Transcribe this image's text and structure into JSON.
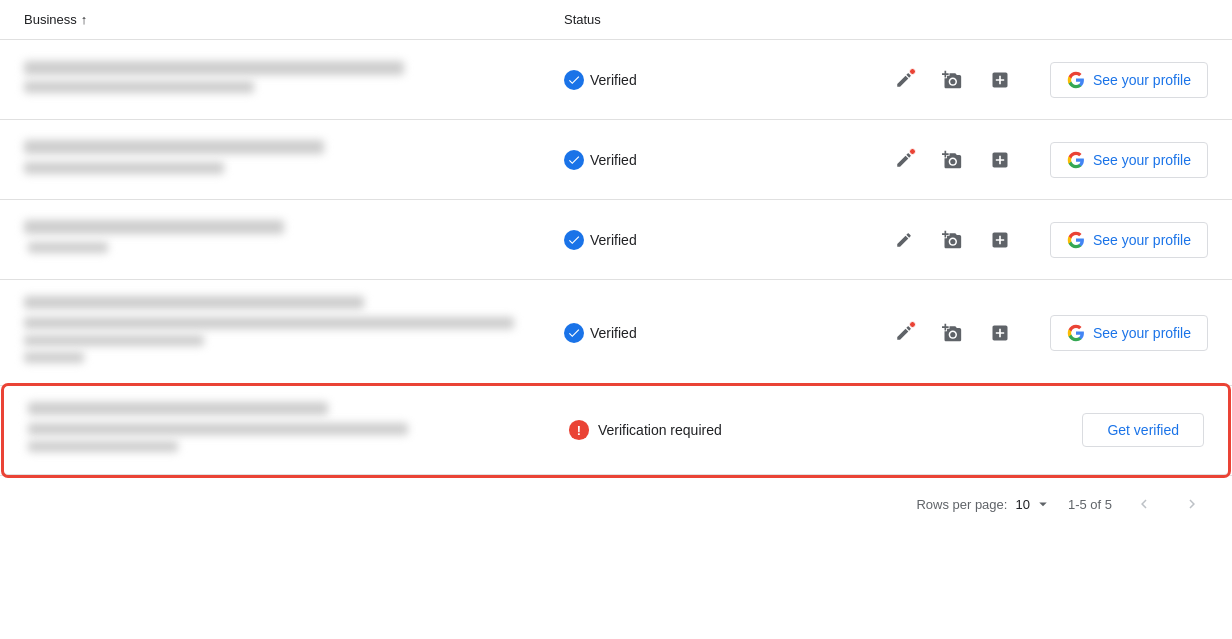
{
  "header": {
    "business_label": "Business",
    "sort_icon": "↑",
    "status_label": "Status"
  },
  "rows": [
    {
      "id": 1,
      "status": "Verified",
      "has_notification": true,
      "see_profile_label": "See your profile",
      "verified": true
    },
    {
      "id": 2,
      "status": "Verified",
      "has_notification": true,
      "see_profile_label": "See your profile",
      "verified": true
    },
    {
      "id": 3,
      "status": "Verified",
      "has_notification": false,
      "see_profile_label": "See your profile",
      "verified": true
    },
    {
      "id": 4,
      "status": "Verified",
      "has_notification": true,
      "see_profile_label": "See your profile",
      "verified": true
    },
    {
      "id": 5,
      "status": "Verification required",
      "has_notification": false,
      "get_verified_label": "Get verified",
      "verified": false
    }
  ],
  "pagination": {
    "rows_per_page_label": "Rows per page:",
    "rows_per_page_value": "10",
    "page_info": "1-5 of 5"
  },
  "colors": {
    "verified_blue": "#1a73e8",
    "error_red": "#ea4335",
    "border": "#dadce0",
    "text_secondary": "#5f6368"
  }
}
